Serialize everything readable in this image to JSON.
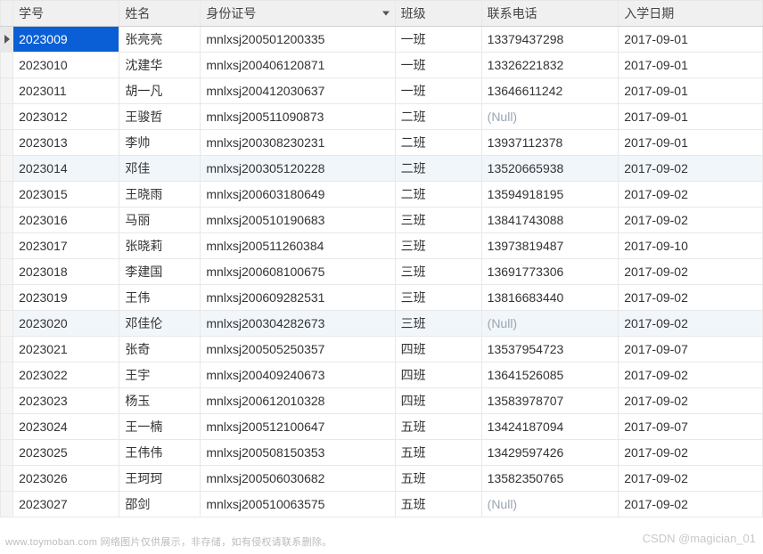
{
  "headers": {
    "student_id": "学号",
    "name": "姓名",
    "id_number": "身份证号",
    "class": "班级",
    "phone": "联系电话",
    "enroll_date": "入学日期"
  },
  "null_label": "(Null)",
  "selected_row_index": 0,
  "selected_col_key": "student_id",
  "sorted_col_key": "id_number",
  "rows": [
    {
      "student_id": "2023009",
      "name": "张亮亮",
      "id_number": "mnlxsj200501200335",
      "class": "一班",
      "phone": "13379437298",
      "enroll_date": "2017-09-01"
    },
    {
      "student_id": "2023010",
      "name": "沈建华",
      "id_number": "mnlxsj200406120871",
      "class": "一班",
      "phone": "13326221832",
      "enroll_date": "2017-09-01"
    },
    {
      "student_id": "2023011",
      "name": "胡一凡",
      "id_number": "mnlxsj200412030637",
      "class": "一班",
      "phone": "13646611242",
      "enroll_date": "2017-09-01"
    },
    {
      "student_id": "2023012",
      "name": "王骏哲",
      "id_number": "mnlxsj200511090873",
      "class": "二班",
      "phone": null,
      "enroll_date": "2017-09-01"
    },
    {
      "student_id": "2023013",
      "name": "李帅",
      "id_number": "mnlxsj200308230231",
      "class": "二班",
      "phone": "13937112378",
      "enroll_date": "2017-09-01"
    },
    {
      "student_id": "2023014",
      "name": "邓佳",
      "id_number": "mnlxsj200305120228",
      "class": "二班",
      "phone": "13520665938",
      "enroll_date": "2017-09-02"
    },
    {
      "student_id": "2023015",
      "name": "王晓雨",
      "id_number": "mnlxsj200603180649",
      "class": "二班",
      "phone": "13594918195",
      "enroll_date": "2017-09-02"
    },
    {
      "student_id": "2023016",
      "name": "马丽",
      "id_number": "mnlxsj200510190683",
      "class": "三班",
      "phone": "13841743088",
      "enroll_date": "2017-09-02"
    },
    {
      "student_id": "2023017",
      "name": "张晓莉",
      "id_number": "mnlxsj200511260384",
      "class": "三班",
      "phone": "13973819487",
      "enroll_date": "2017-09-10"
    },
    {
      "student_id": "2023018",
      "name": "李建国",
      "id_number": "mnlxsj200608100675",
      "class": "三班",
      "phone": "13691773306",
      "enroll_date": "2017-09-02"
    },
    {
      "student_id": "2023019",
      "name": "王伟",
      "id_number": "mnlxsj200609282531",
      "class": "三班",
      "phone": "13816683440",
      "enroll_date": "2017-09-02"
    },
    {
      "student_id": "2023020",
      "name": "邓佳伦",
      "id_number": "mnlxsj200304282673",
      "class": "三班",
      "phone": null,
      "enroll_date": "2017-09-02"
    },
    {
      "student_id": "2023021",
      "name": "张奇",
      "id_number": "mnlxsj200505250357",
      "class": "四班",
      "phone": "13537954723",
      "enroll_date": "2017-09-07"
    },
    {
      "student_id": "2023022",
      "name": "王宇",
      "id_number": "mnlxsj200409240673",
      "class": "四班",
      "phone": "13641526085",
      "enroll_date": "2017-09-02"
    },
    {
      "student_id": "2023023",
      "name": "杨玉",
      "id_number": "mnlxsj200612010328",
      "class": "四班",
      "phone": "13583978707",
      "enroll_date": "2017-09-02"
    },
    {
      "student_id": "2023024",
      "name": "王一楠",
      "id_number": "mnlxsj200512100647",
      "class": "五班",
      "phone": "13424187094",
      "enroll_date": "2017-09-07"
    },
    {
      "student_id": "2023025",
      "name": "王伟伟",
      "id_number": "mnlxsj200508150353",
      "class": "五班",
      "phone": "13429597426",
      "enroll_date": "2017-09-02"
    },
    {
      "student_id": "2023026",
      "name": "王珂珂",
      "id_number": "mnlxsj200506030682",
      "class": "五班",
      "phone": "13582350765",
      "enroll_date": "2017-09-02"
    },
    {
      "student_id": "2023027",
      "name": "邵剑",
      "id_number": "mnlxsj200510063575",
      "class": "五班",
      "phone": null,
      "enroll_date": "2017-09-02"
    }
  ],
  "watermarks": {
    "left": "www.toymoban.com  网络图片仅供展示，非存储，如有侵权请联系删除。",
    "right": "CSDN @magician_01"
  }
}
